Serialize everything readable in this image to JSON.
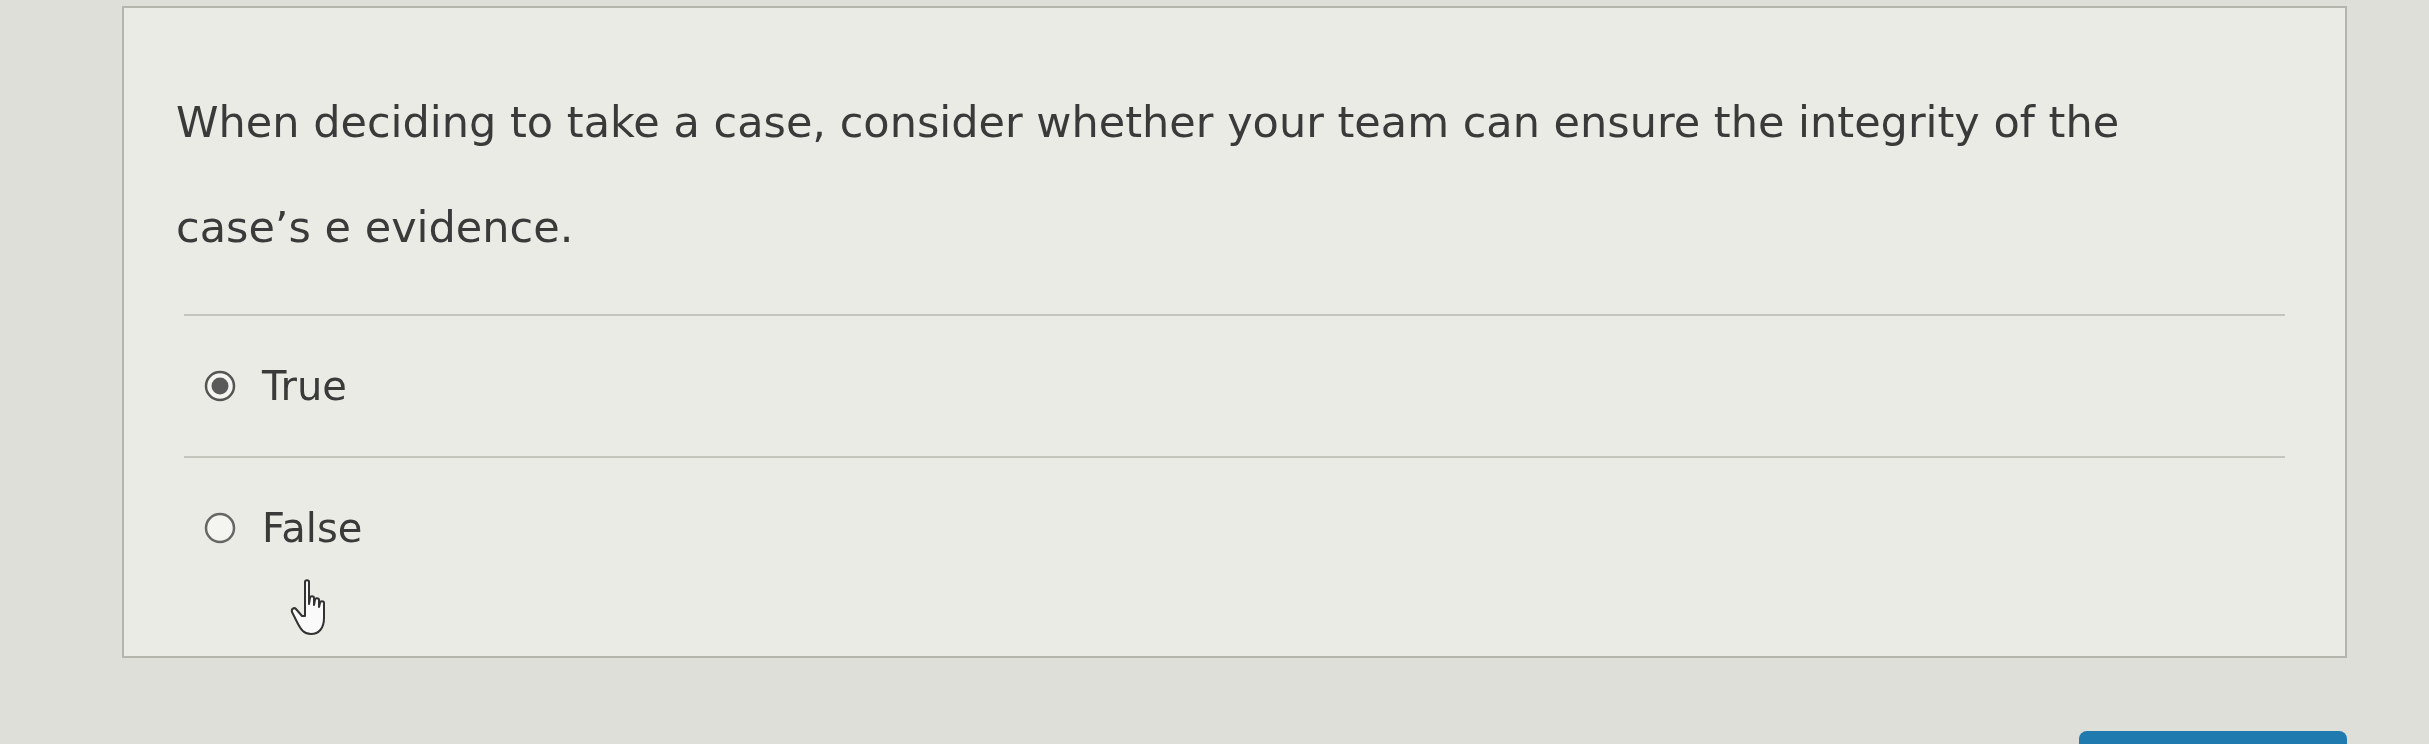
{
  "question": {
    "text": "When deciding to take a case, consider whether your team can ensure the integrity of the case’s e evidence."
  },
  "options": [
    {
      "label": "True",
      "selected": true
    },
    {
      "label": "False",
      "selected": false
    }
  ]
}
